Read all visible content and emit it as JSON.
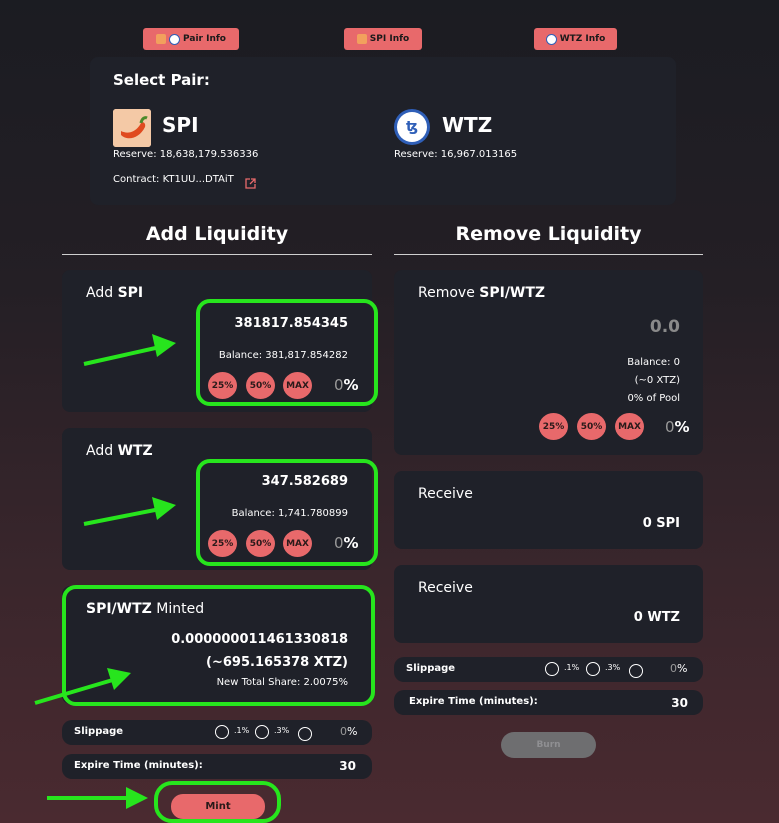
{
  "top_buttons": {
    "pair_info": "Pair Info",
    "spi_info": "SPI Info",
    "wtz_info": "WTZ Info"
  },
  "select_pair": {
    "title": "Select Pair:",
    "token_a": {
      "symbol": "SPI",
      "reserve": "Reserve: 18,638,179.536336",
      "contract": "Contract: KT1UU...DTAiT"
    },
    "token_b": {
      "symbol": "WTZ",
      "reserve": "Reserve: 16,967.013165"
    }
  },
  "add_liquidity": {
    "title": "Add Liquidity",
    "spi": {
      "label_prefix": "Add ",
      "label_token": "SPI",
      "amount": "381817.854345",
      "balance": "Balance: 381,817.854282",
      "p25": "25%",
      "p50": "50%",
      "max": "MAX",
      "pct_value": "0",
      "pct_sign": "%"
    },
    "wtz": {
      "label_prefix": "Add ",
      "label_token": "WTZ",
      "amount": "347.582689",
      "balance": "Balance: 1,741.780899",
      "p25": "25%",
      "p50": "50%",
      "max": "MAX",
      "pct_value": "0",
      "pct_sign": "%"
    },
    "minted": {
      "label_token": "SPI/WTZ",
      "label_suffix": " Minted",
      "amount": "0.000000011461330818",
      "xtz": "(~695.165378 XTZ)",
      "share": "New Total Share: 2.0075%"
    },
    "slippage": {
      "label": "Slippage",
      "opt1": ".1%",
      "opt2": ".3%",
      "value": "0",
      "sign": "%"
    },
    "expire": {
      "label": "Expire Time (minutes):",
      "value": "30"
    },
    "mint_label": "Mint"
  },
  "remove_liquidity": {
    "title": "Remove Liquidity",
    "label_prefix": "Remove ",
    "label_token": "SPI/WTZ",
    "amount": "0.0",
    "balance": "Balance: 0",
    "xtz": "(~0 XTZ)",
    "pool": "0% of Pool",
    "p25": "25%",
    "p50": "50%",
    "max": "MAX",
    "pct_value": "0",
    "pct_sign": "%",
    "receive1": {
      "label": "Receive",
      "value": "0 SPI"
    },
    "receive2": {
      "label": "Receive",
      "value": "0 WTZ"
    },
    "slippage": {
      "label": "Slippage",
      "opt1": ".1%",
      "opt2": ".3%",
      "value": "0",
      "sign": "%"
    },
    "expire": {
      "label": "Expire Time (minutes):",
      "value": "30"
    },
    "burn_label": "Burn"
  },
  "colors": {
    "accent": "#e8696b",
    "highlight": "#27e51d",
    "panel": "#1f2129"
  }
}
